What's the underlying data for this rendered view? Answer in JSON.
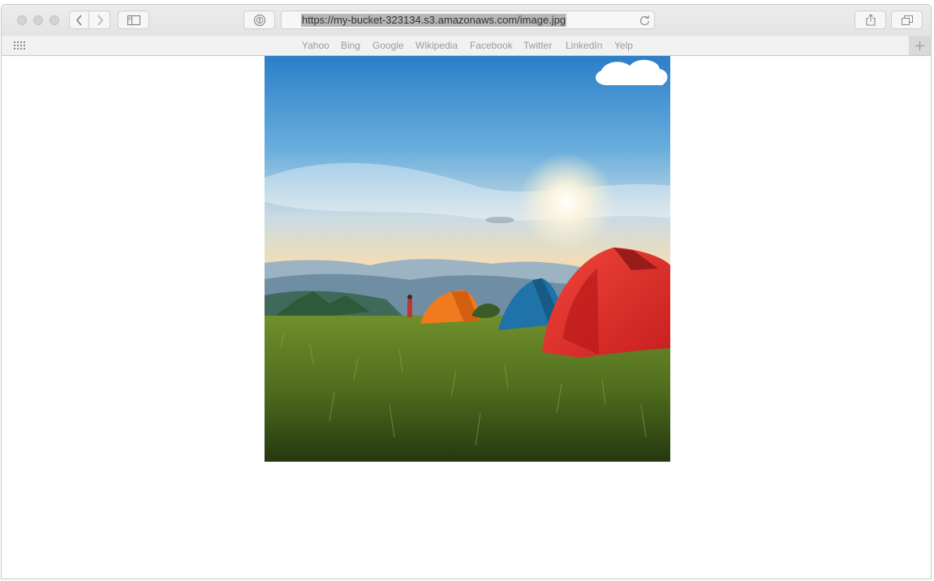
{
  "browser": {
    "url": "https://my-bucket-323134.s3.amazonaws.com/image.jpg",
    "favorites": [
      "Yahoo",
      "Bing",
      "Google",
      "Wikipedia",
      "Facebook",
      "Twitter",
      "LinkedIn",
      "Yelp"
    ]
  },
  "icons": {
    "close": "traffic-light-close-icon",
    "minimize": "traffic-light-minimize-icon",
    "zoom": "traffic-light-zoom-icon",
    "back": "chevron-left-icon",
    "forward": "chevron-right-icon",
    "sidebar": "sidebar-icon",
    "privacy": "privacy-report-icon",
    "reload": "reload-icon",
    "share": "share-icon",
    "tabs": "tab-overview-icon",
    "favorites_grid": "grid-icon",
    "new_tab": "plus-icon"
  },
  "colors": {
    "toolbar": "#e8e8e8",
    "favorites_bar": "#f1f1f1",
    "url_highlight": "#b7b7b7"
  }
}
